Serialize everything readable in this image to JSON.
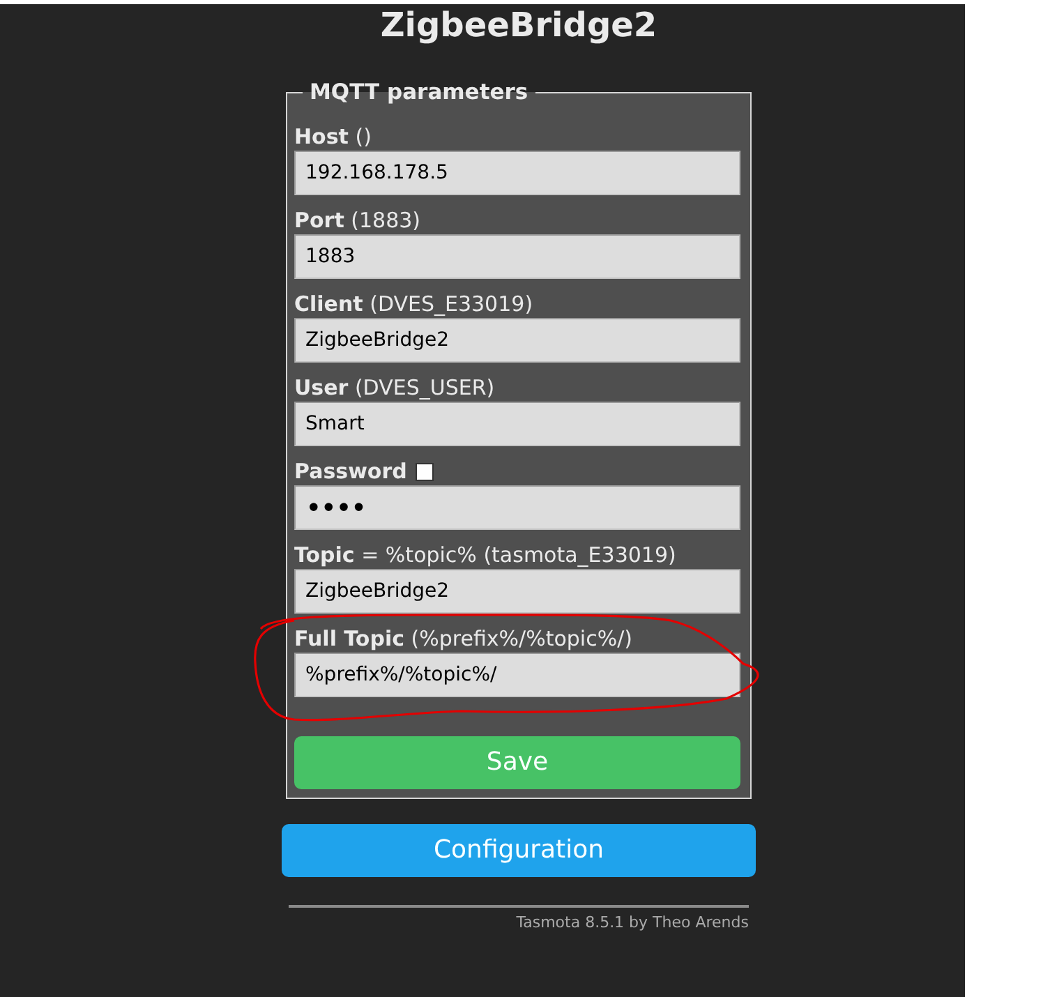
{
  "page": {
    "title": "ZigbeeBridge2"
  },
  "mqtt": {
    "legend": "MQTT parameters",
    "fields": [
      {
        "label": "Host",
        "hint": "()",
        "kind": "text",
        "value": "192.168.178.5",
        "annotated": false
      },
      {
        "label": "Port",
        "hint": "(1883)",
        "kind": "text",
        "value": "1883",
        "annotated": false
      },
      {
        "label": "Client",
        "hint": "(DVES_E33019)",
        "kind": "text",
        "value": "ZigbeeBridge2",
        "annotated": false
      },
      {
        "label": "User",
        "hint": "(DVES_USER)",
        "kind": "text",
        "value": "Smart",
        "annotated": false
      },
      {
        "label": "Password",
        "kind": "password",
        "value": "••••",
        "checkbox": {
          "checked": false
        },
        "annotated": false
      },
      {
        "label": "Topic",
        "hint": "= %topic% (tasmota_E33019)",
        "kind": "text",
        "value": "ZigbeeBridge2",
        "annotated": false
      },
      {
        "label": "Full Topic",
        "hint": "(%prefix%/%topic%/)",
        "kind": "text",
        "value": "%prefix%/%topic%/",
        "annotated": true
      }
    ],
    "save_button": "Save"
  },
  "buttons": [
    "Configuration"
  ],
  "footer": "Tasmota 8.5.1 by Theo Arends"
}
